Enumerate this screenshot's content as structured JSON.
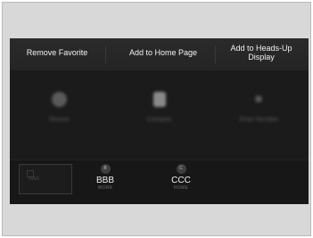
{
  "menu": {
    "remove_favorite": "Remove Favorite",
    "add_to_home_page": "Add to Home Page",
    "add_to_hud_line1": "Add to Heads-Up",
    "add_to_hud_line2": "Display"
  },
  "background_tiles": [
    {
      "icon": "circle-icon",
      "label": "Recent"
    },
    {
      "icon": "contacts-icon",
      "label": "Contacts"
    },
    {
      "icon": "dot-icon",
      "label": "Enter Number"
    }
  ],
  "favorites": {
    "first": {
      "label": "AAA"
    },
    "second": {
      "badge": "B",
      "name": "BBB",
      "sub": "WORK"
    },
    "third": {
      "badge": "C",
      "name": "CCC",
      "sub": "HOME"
    }
  },
  "colors": {
    "screen_bg": "#1b1b1b",
    "menu_text": "#f2f2f2",
    "frame_bg": "#d8d8d8"
  }
}
